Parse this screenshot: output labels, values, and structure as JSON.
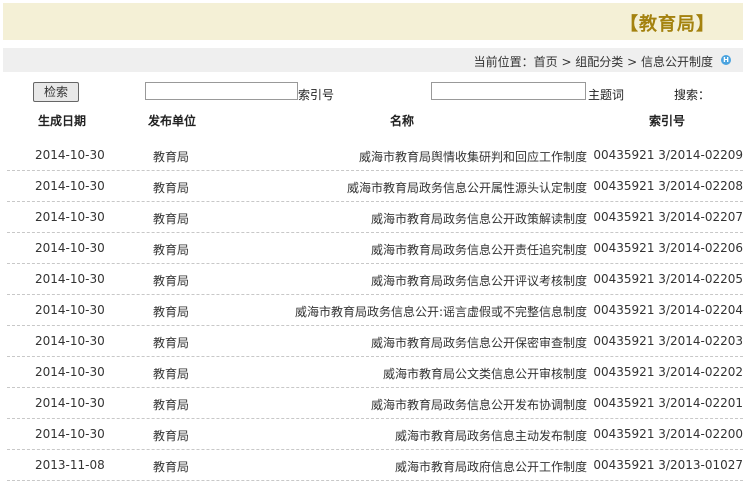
{
  "header": {
    "title": "【教育局】"
  },
  "breadcrumb": {
    "label": "当前位置：",
    "path": "首页 > 组配分类 > 信息公开制度"
  },
  "search": {
    "label": "搜索：",
    "subject_label": "主题词",
    "index_label": "索引号",
    "button_label": "检索",
    "subject_value": "",
    "index_value": ""
  },
  "table": {
    "headers": {
      "index": "索引号",
      "name": "名称",
      "unit": "发布单位",
      "date": "生成日期"
    },
    "rows": [
      {
        "index": "00435921 3/2014-02209",
        "name": "威海市教育局舆情收集研判和回应工作制度",
        "unit": "教育局",
        "date": "2014-10-30"
      },
      {
        "index": "00435921 3/2014-02208",
        "name": "威海市教育局政务信息公开属性源头认定制度",
        "unit": "教育局",
        "date": "2014-10-30"
      },
      {
        "index": "00435921 3/2014-02207",
        "name": "威海市教育局政务信息公开政策解读制度",
        "unit": "教育局",
        "date": "2014-10-30"
      },
      {
        "index": "00435921 3/2014-02206",
        "name": "威海市教育局政务信息公开责任追究制度",
        "unit": "教育局",
        "date": "2014-10-30"
      },
      {
        "index": "00435921 3/2014-02205",
        "name": "威海市教育局政务信息公开评议考核制度",
        "unit": "教育局",
        "date": "2014-10-30"
      },
      {
        "index": "00435921 3/2014-02204",
        "name": "威海市教育局政务信息公开:谣言虚假或不完整信息制度",
        "unit": "教育局",
        "date": "2014-10-30"
      },
      {
        "index": "00435921 3/2014-02203",
        "name": "威海市教育局政务信息公开保密审查制度",
        "unit": "教育局",
        "date": "2014-10-30"
      },
      {
        "index": "00435921 3/2014-02202",
        "name": "威海市教育局公文类信息公开审核制度",
        "unit": "教育局",
        "date": "2014-10-30"
      },
      {
        "index": "00435921 3/2014-02201",
        "name": "威海市教育局政务信息公开发布协调制度",
        "unit": "教育局",
        "date": "2014-10-30"
      },
      {
        "index": "00435921 3/2014-02200",
        "name": "威海市教育局政务信息主动发布制度",
        "unit": "教育局",
        "date": "2014-10-30"
      },
      {
        "index": "00435921 3/2013-01027",
        "name": "威海市教育局政府信息公开工作制度",
        "unit": "教育局",
        "date": "2013-11-08"
      }
    ]
  }
}
